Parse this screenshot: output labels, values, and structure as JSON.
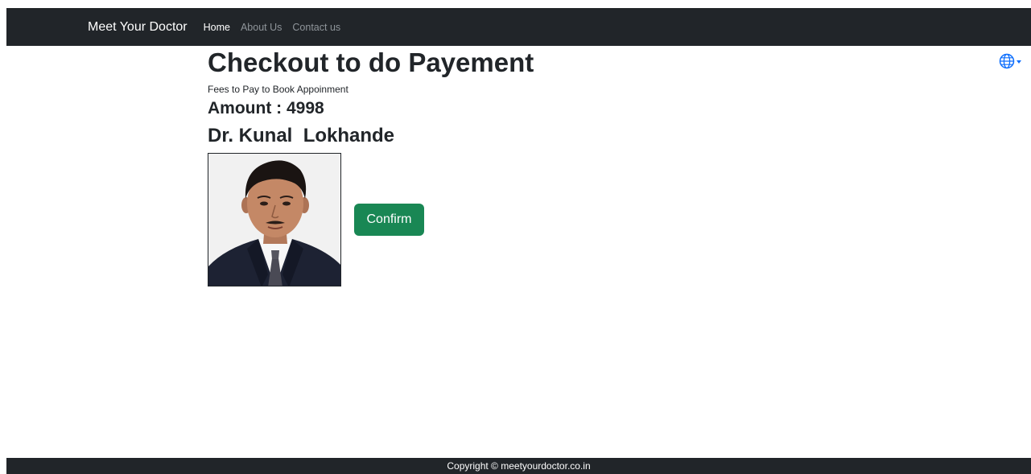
{
  "navbar": {
    "brand": "Meet Your Doctor",
    "links": [
      {
        "label": "Home",
        "active": true
      },
      {
        "label": "About Us",
        "active": false
      },
      {
        "label": "Contact us",
        "active": false
      }
    ],
    "language_icon": "globe-icon",
    "accent_color": "#0d6efd"
  },
  "main": {
    "title": "Checkout to do Payement",
    "fees_label": "Fees to Pay to Book Appoinment",
    "amount_line": "Amount : 4998",
    "doctor_name": "Dr. Kunal  Lokhande",
    "confirm_label": "Confirm",
    "confirm_color": "#198754"
  },
  "footer": {
    "copyright": "Copyright © meetyourdoctor.co.in"
  },
  "colors": {
    "navbar_bg": "#212529",
    "nav_inactive": "#8f959a"
  }
}
